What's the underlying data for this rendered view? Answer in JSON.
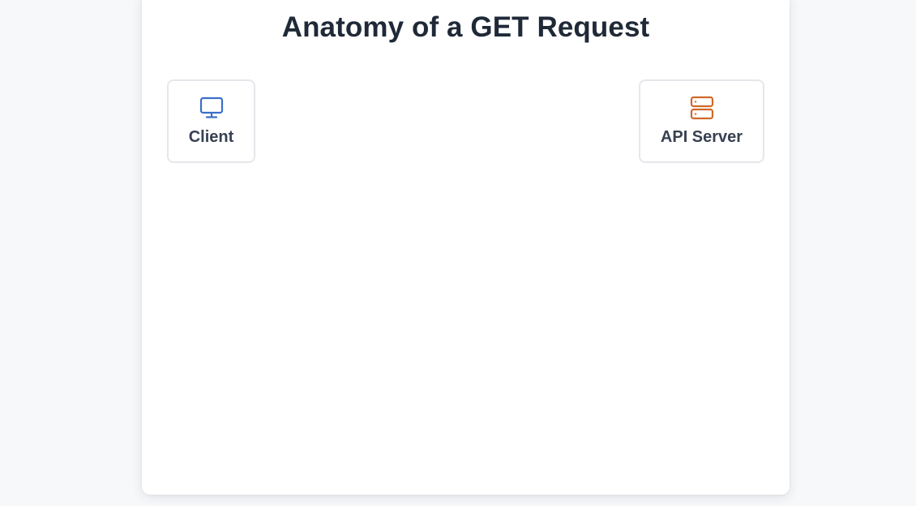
{
  "diagram": {
    "title": "Anatomy of a GET Request",
    "nodes": {
      "client": {
        "label": "Client",
        "icon": "monitor-icon",
        "color": "#3b6fc9"
      },
      "server": {
        "label": "API Server",
        "icon": "server-icon",
        "color": "#d0692a"
      }
    }
  }
}
